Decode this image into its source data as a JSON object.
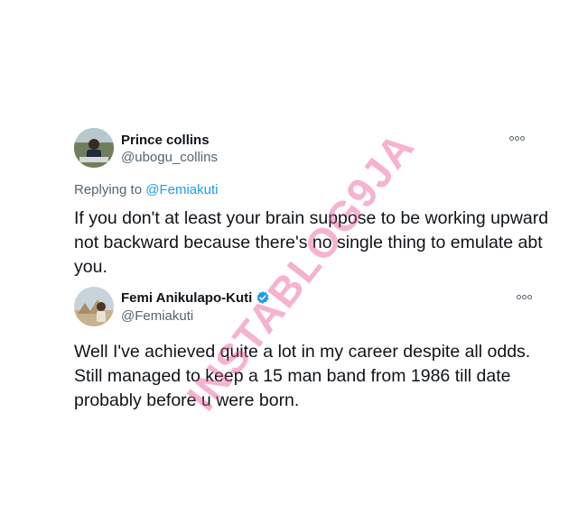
{
  "tweets": [
    {
      "name": "Prince collins",
      "handle": "@ubogu_collins",
      "replying_prefix": "Replying to ",
      "replying_mention": "@Femiakuti",
      "text": "If you don't at least your brain suppose to be working upward not backward because there's no single thing to emulate abt you."
    },
    {
      "name": "Femi Anikulapo-Kuti",
      "handle": "@Femiakuti",
      "verified": true,
      "text": "Well I've achieved quite a lot in my career despite all odds. Still managed to keep a 15 man band from 1986 till date probably before u were born."
    }
  ],
  "watermark": "INSTABLOG9JA",
  "colors": {
    "mention": "#1d9bf0",
    "secondary_text": "#536471",
    "verified_badge": "#1d9bf0",
    "watermark": "#e84b8c"
  },
  "icons": {
    "more": "more-options-icon",
    "verified": "verified-badge-icon"
  }
}
